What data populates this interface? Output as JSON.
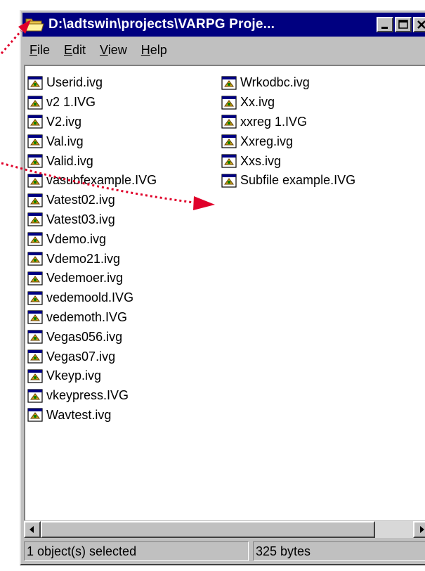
{
  "window": {
    "title": "D:\\adtswin\\projects\\VARPG Proje..."
  },
  "menu": [
    {
      "accel": "F",
      "rest": "ile"
    },
    {
      "accel": "E",
      "rest": "dit"
    },
    {
      "accel": "V",
      "rest": "iew"
    },
    {
      "accel": "H",
      "rest": "elp"
    }
  ],
  "files_column_1": [
    "Userid.ivg",
    "v2 1.IVG",
    "V2.ivg",
    "Val.ivg",
    "Valid.ivg",
    "vasubfexample.IVG",
    "Vatest02.ivg",
    "Vatest03.ivg",
    "Vdemo.ivg",
    "Vdemo21.ivg",
    "Vedemoer.ivg",
    "vedemoold.IVG",
    "vedemoth.IVG",
    "Vegas056.ivg",
    "Vegas07.ivg",
    "Vkeyp.ivg",
    "vkeypress.IVG",
    "Wavtest.ivg"
  ],
  "files_column_2": [
    "Wrkodbc.ivg",
    "Xx.ivg",
    "xxreg 1.IVG",
    "Xxreg.ivg",
    "Xxs.ivg",
    "Subfile example.IVG"
  ],
  "status": {
    "selected": "1 object(s) selected",
    "size": "325 bytes"
  },
  "colors": {
    "titlebar": "#000080",
    "face": "#c0c0c0",
    "annotation_arrow": "#e0002a"
  },
  "icons": {
    "title": "folder-icon",
    "file": "ivg-file-icon"
  }
}
